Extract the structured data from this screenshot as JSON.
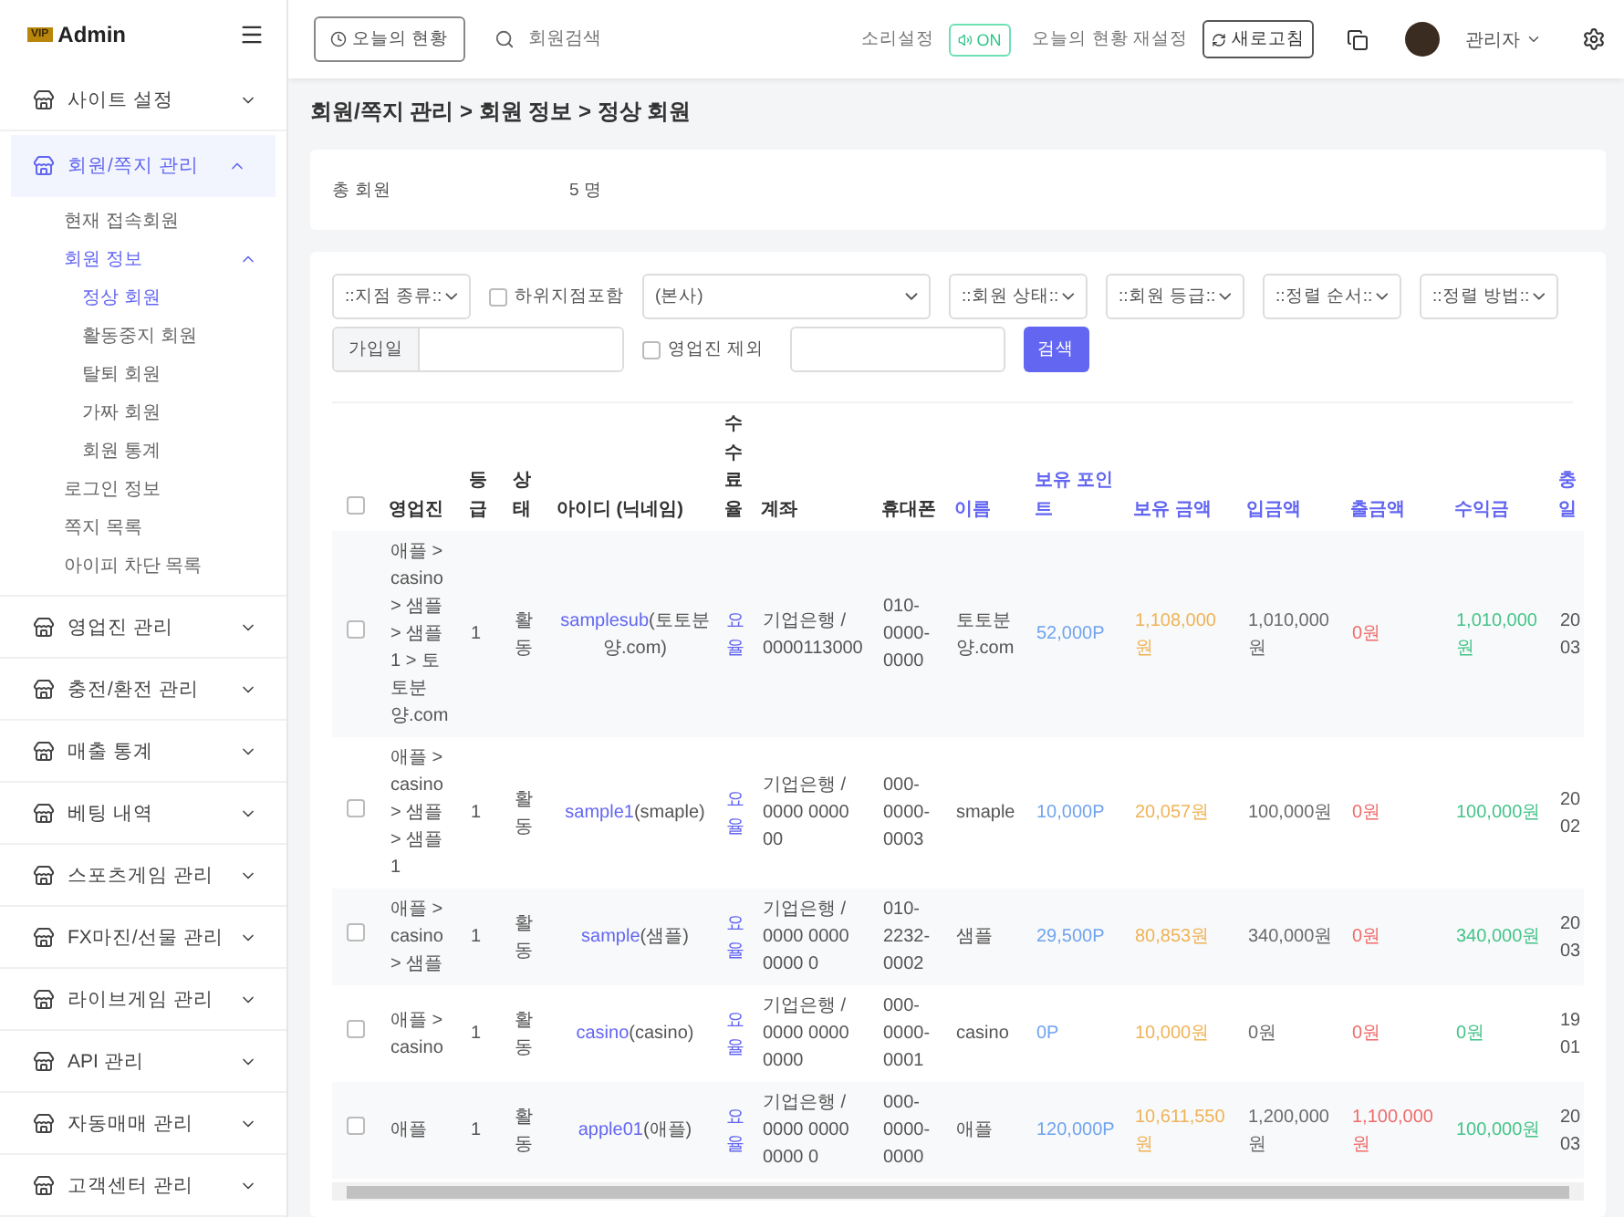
{
  "sidebar": {
    "logo_badge": "VIP",
    "logo": "Admin",
    "items": [
      {
        "label": "사이트 설정",
        "expanded": false,
        "selected": false
      },
      {
        "label": "회원/쪽지 관리",
        "expanded": true,
        "selected": true,
        "children": [
          {
            "label": "현재 접속회원",
            "selected": false
          },
          {
            "label": "회원 정보",
            "selected": true,
            "expanded": true,
            "children": [
              {
                "label": "정상 회원",
                "selected": true
              },
              {
                "label": "활동중지 회원",
                "selected": false
              },
              {
                "label": "탈퇴 회원",
                "selected": false
              },
              {
                "label": "가짜 회원",
                "selected": false
              },
              {
                "label": "회원 통계",
                "selected": false
              }
            ]
          },
          {
            "label": "로그인 정보",
            "selected": false
          },
          {
            "label": "쪽지 목록",
            "selected": false
          },
          {
            "label": "아이피 차단 목록",
            "selected": false
          }
        ]
      },
      {
        "label": "영업진 관리",
        "expanded": false,
        "selected": false
      },
      {
        "label": "충전/환전 관리",
        "expanded": false,
        "selected": false
      },
      {
        "label": "매출 통계",
        "expanded": false,
        "selected": false
      },
      {
        "label": "베팅 내역",
        "expanded": false,
        "selected": false
      },
      {
        "label": "스포츠게임 관리",
        "expanded": false,
        "selected": false
      },
      {
        "label": "FX마진/선물 관리",
        "expanded": false,
        "selected": false
      },
      {
        "label": "라이브게임 관리",
        "expanded": false,
        "selected": false
      },
      {
        "label": "API 관리",
        "expanded": false,
        "selected": false
      },
      {
        "label": "자동매매 관리",
        "expanded": false,
        "selected": false
      },
      {
        "label": "고객센터 관리",
        "expanded": false,
        "selected": false
      }
    ]
  },
  "topbar": {
    "today_button": "오늘의 현황",
    "search": {
      "placeholder": "회원검색"
    },
    "sound_label": "소리설정",
    "sound_toggle": {
      "label": "ON",
      "on": true
    },
    "reset_label": "오늘의 현황 재설정",
    "refresh_button": "새로고침",
    "user": "관리자"
  },
  "breadcrumb": "회원/쪽지 관리 > 회원 정보 > 정상 회원",
  "summary": {
    "label": "총 회원",
    "value": "5 명"
  },
  "filters": [
    {
      "kind": "select",
      "label": "::지점 종류::"
    },
    {
      "kind": "checkbox",
      "label": "하위지점포함",
      "checked": false
    },
    {
      "kind": "wide_select",
      "label": "(본사)"
    },
    {
      "kind": "select",
      "label": "::회원 상태::"
    },
    {
      "kind": "select",
      "label": "::회원 등급::"
    },
    {
      "kind": "select",
      "label": "::정렬 순서::"
    },
    {
      "kind": "select",
      "label": "::정렬 방법::"
    },
    {
      "kind": "date",
      "label": "가입일"
    },
    {
      "kind": "checkbox",
      "label": "영업진 제외",
      "checked": false
    },
    {
      "kind": "input"
    },
    {
      "kind": "button",
      "label": "검색"
    }
  ],
  "table": {
    "all_checked": false,
    "columns": [
      {
        "label": "영업진",
        "sortable": false
      },
      {
        "label": "등급",
        "sortable": false
      },
      {
        "label": "상태",
        "sortable": false
      },
      {
        "label": "아이디 (닉네임)",
        "sortable": false
      },
      {
        "label": "수수료율",
        "sortable": false
      },
      {
        "label": "계좌",
        "sortable": false
      },
      {
        "label": "휴대폰",
        "sortable": false
      },
      {
        "label": "이름",
        "sortable": true
      },
      {
        "label": "보유 포인트",
        "sortable": true,
        "color": "#6fa3ef"
      },
      {
        "label": "보유 금액",
        "sortable": true,
        "color": "#f0b357"
      },
      {
        "label": "입금액",
        "sortable": true,
        "color": "#6b6b6b"
      },
      {
        "label": "출금액",
        "sortable": true,
        "color": "#ef6b6b"
      },
      {
        "label": "수익금",
        "sortable": true,
        "color": "#45c489"
      },
      {
        "label": "충 일",
        "sortable": true
      }
    ],
    "rows": [
      {
        "checked": false,
        "cells": [
          "애플 > casino > 샘플 > 샘플 1 > 토토분양.com",
          "1",
          "활동",
          {
            "id": "samplesub",
            "nick": "(토토분양.com)"
          },
          "요율",
          "기업은행 / 0000113000",
          "010-0000-0000",
          "토토분양.com",
          "52,000P",
          "1,108,000원",
          "1,010,000원",
          "0원",
          "1,010,000원",
          "20 03"
        ]
      },
      {
        "checked": false,
        "cells": [
          "애플 > casino > 샘플 > 샘플 1",
          "1",
          "활동",
          {
            "id": "sample1",
            "nick": "(smaple)"
          },
          "요율",
          "기업은행 / 0000 0000 00",
          "000-0000-0003",
          "smaple",
          "10,000P",
          "20,057원",
          "100,000원",
          "0원",
          "100,000원",
          "20 02"
        ]
      },
      {
        "checked": false,
        "cells": [
          "애플 > casino > 샘플",
          "1",
          "활동",
          {
            "id": "sample",
            "nick": "(샘플)"
          },
          "요율",
          "기업은행 / 0000 0000 0000 0",
          "010-2232-0002",
          "샘플",
          "29,500P",
          "80,853원",
          "340,000원",
          "0원",
          "340,000원",
          "20 03"
        ]
      },
      {
        "checked": false,
        "cells": [
          "애플 > casino",
          "1",
          "활동",
          {
            "id": "casino",
            "nick": "(casino)"
          },
          "요율",
          "기업은행 / 0000 0000 0000",
          "000-0000-0001",
          "casino",
          "0P",
          "10,000원",
          "0원",
          "0원",
          "0원",
          "19 01"
        ]
      },
      {
        "checked": false,
        "cells": [
          "애플",
          "1",
          "활동",
          {
            "id": "apple01",
            "nick": "(애플)"
          },
          "요율",
          "기업은행 / 0000 0000 0000 0",
          "000-0000-0000",
          "애플",
          "120,000P",
          "10,611,550원",
          "1,200,000원",
          "1,100,000원",
          "100,000원",
          "20 03"
        ]
      }
    ]
  }
}
